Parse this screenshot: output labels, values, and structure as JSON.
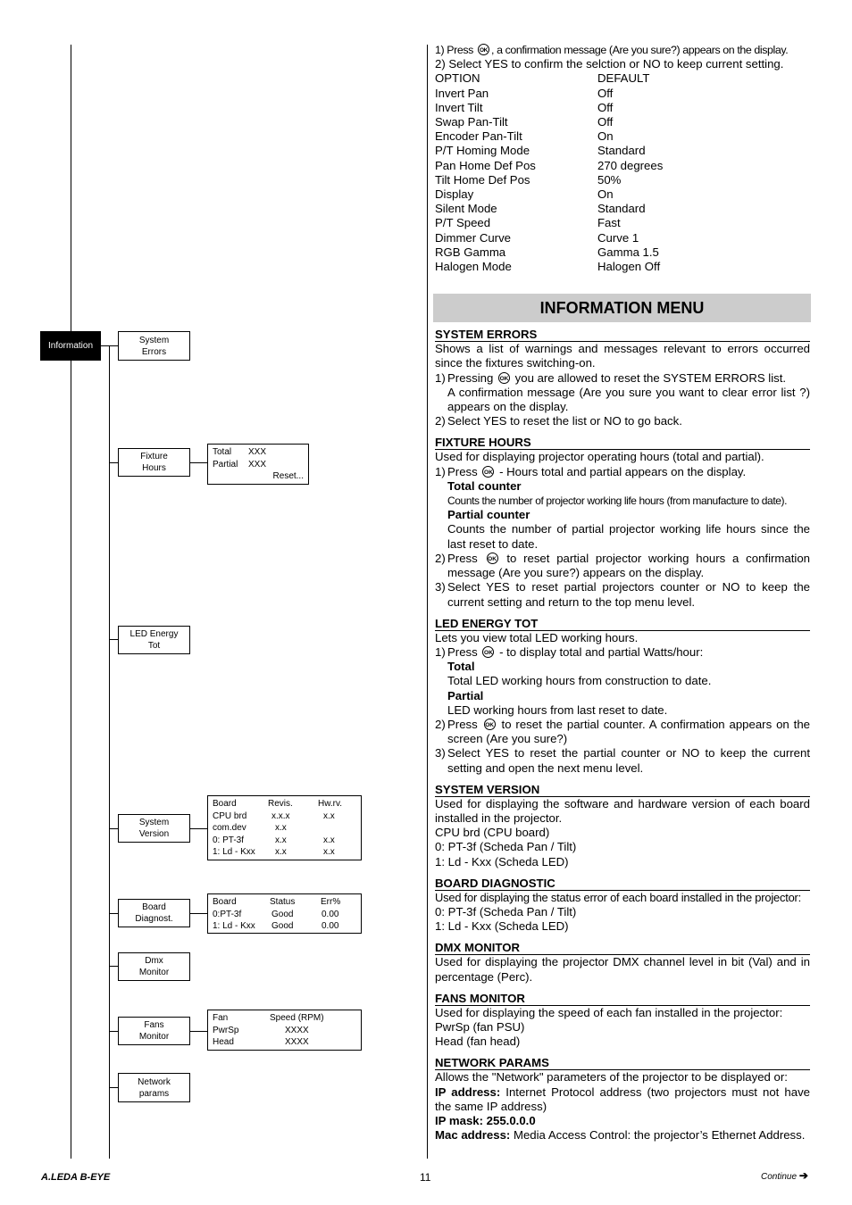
{
  "intro": {
    "step1_pre": "1) Press",
    "step1_post": ", a confirmation message (Are you sure?) appears on the display.",
    "step2": "2) Select YES to confirm the selction or NO to keep current setting."
  },
  "options_table": {
    "header": {
      "option": "OPTION",
      "default": "DEFAULT"
    },
    "rows": [
      {
        "option": "Invert Pan",
        "default": "Off"
      },
      {
        "option": "Invert Tilt",
        "default": "Off"
      },
      {
        "option": "Swap Pan-Tilt",
        "default": "Off"
      },
      {
        "option": "Encoder Pan-Tilt",
        "default": "On"
      },
      {
        "option": "P/T Homing Mode",
        "default": "Standard"
      },
      {
        "option": "Pan Home Def Pos",
        "default": "270 degrees"
      },
      {
        "option": "Tilt Home Def Pos",
        "default": "50%"
      },
      {
        "option": "Display",
        "default": "On"
      },
      {
        "option": "Silent Mode",
        "default": "Standard"
      },
      {
        "option": "P/T Speed",
        "default": "Fast"
      },
      {
        "option": "Dimmer Curve",
        "default": "Curve 1"
      },
      {
        "option": "RGB Gamma",
        "default": "Gamma 1.5"
      },
      {
        "option": "Halogen Mode",
        "default": "Halogen Off"
      }
    ]
  },
  "ok_icon_label": "OK",
  "banner_title": "INFORMATION MENU",
  "diagram": {
    "root": "Information",
    "items": {
      "system_errors": [
        "System",
        "Errors"
      ],
      "fixture_hours": [
        "Fixture",
        "Hours"
      ],
      "led_energy": [
        "LED Energy",
        "Tot"
      ],
      "system_version": [
        "System",
        "Version"
      ],
      "board_diag": [
        "Board",
        "Diagnost."
      ],
      "dmx_monitor": [
        "Dmx",
        "Monitor"
      ],
      "fans_monitor": [
        "Fans",
        "Monitor"
      ],
      "network_params": [
        "Network",
        "params"
      ]
    },
    "fixture_hours_display": {
      "rows": [
        [
          "Total",
          "XXX"
        ],
        [
          "Partial",
          "XXX"
        ]
      ],
      "reset": "Reset..."
    },
    "system_version_display": {
      "header": [
        "Board",
        "Revis.",
        "Hw.rv."
      ],
      "rows": [
        [
          "CPU brd",
          "x.x.x",
          "x.x"
        ],
        [
          "com.dev",
          "x.x",
          ""
        ],
        [
          "0: PT-3f",
          "x.x",
          "x.x"
        ],
        [
          "1: Ld - Kxx",
          "x.x",
          "x.x"
        ]
      ]
    },
    "board_diag_display": {
      "header": [
        "Board",
        "Status",
        "Err%"
      ],
      "rows": [
        [
          "0:PT-3f",
          "Good",
          "0.00"
        ],
        [
          "1: Ld - Kxx",
          "Good",
          "0.00"
        ]
      ]
    },
    "fans_display": {
      "header": [
        "Fan",
        "Speed (RPM)"
      ],
      "rows": [
        [
          "PwrSp",
          "XXXX"
        ],
        [
          "Head",
          "XXXX"
        ]
      ]
    }
  },
  "sections": {
    "system_errors": {
      "title": "SYSTEM ERRORS",
      "desc": "Shows a list of warnings and messages relevant to errors occurred since the fixtures switching-on.",
      "s1_n": "1)",
      "s1_pre": "Pressing",
      "s1_post": "you are allowed to reset the SYSTEM ERRORS list.",
      "s1_cont": "A confirmation message (Are you sure you want to clear error list ?) appears on the display.",
      "s2_n": "2)",
      "s2": "Select YES to reset the list or NO to go back."
    },
    "fixture_hours": {
      "title": "FIXTURE HOURS",
      "desc": "Used for displaying projector operating hours (total and partial).",
      "s1_n": "1)",
      "s1_pre": "Press",
      "s1_post": "- Hours total and partial appears on the display.",
      "total_title": "Total counter",
      "total_desc": "Counts the number of projector working life hours (from manufacture to date).",
      "partial_title": "Partial counter",
      "partial_desc": "Counts the number of partial projector working life hours since the last reset to date.",
      "s2_n": "2)",
      "s2_pre": "Press",
      "s2_post": "to reset partial projector working hours a confirmation message (Are you sure?) appears on the display.",
      "s3_n": "3)",
      "s3": "Select YES to reset partial projectors counter or NO to keep the current setting and return to the top menu level."
    },
    "led_energy": {
      "title": "LED ENERGY TOT",
      "desc": "Lets you view total LED working hours.",
      "s1_n": "1)",
      "s1_pre": "Press",
      "s1_post": "- to display total and partial Watts/hour:",
      "total_title": "Total",
      "total_desc": "Total LED working hours from construction to date.",
      "partial_title": "Partial",
      "partial_desc": "LED working hours from last reset to date.",
      "s2_n": "2)",
      "s2_pre": "Press",
      "s2_post": "to reset the partial counter. A confirmation appears on the screen (Are you sure?)",
      "s3_n": "3)",
      "s3": "Select YES to reset the partial counter or NO to keep the current setting and open the next menu level."
    },
    "system_version": {
      "title": "SYSTEM VERSION",
      "desc": "Used for displaying the software and hardware version of each board installed in the projector.",
      "lines": [
        "CPU brd (CPU board)",
        "0: PT-3f (Scheda Pan / Tilt)",
        "1: Ld - Kxx (Scheda LED)"
      ]
    },
    "board_diag": {
      "title": "BOARD DIAGNOSTIC",
      "desc": "Used for displaying the status error of each board installed in the projector:",
      "lines": [
        "0: PT-3f (Scheda Pan / Tilt)",
        "1: Ld - Kxx (Scheda LED)"
      ]
    },
    "dmx_monitor": {
      "title": "DMX MONITOR",
      "desc": "Used for displaying the projector DMX channel level in bit (Val) and in percentage (Perc)."
    },
    "fans_monitor": {
      "title": "FANS MONITOR",
      "desc": "Used for displaying the speed of each fan installed in the projector:",
      "lines": [
        "PwrSp (fan PSU)",
        "Head (fan head)"
      ]
    },
    "network_params": {
      "title": "NETWORK PARAMS",
      "desc": "Allows the \"Network\" parameters of the projector to be displayed or:",
      "ip_label": "IP address:",
      "ip_desc": " Internet Protocol address (two projectors must not have the same IP address)",
      "mask_label": "IP mask: 255.0.0.0",
      "mac_label": "Mac address:",
      "mac_desc": " Media Access Control: the projector’s Ethernet Address."
    }
  },
  "footer": {
    "brand": "A.LEDA B-EYE",
    "page_number": "11",
    "continue": "Continue",
    "continue_arrow": "➔"
  }
}
